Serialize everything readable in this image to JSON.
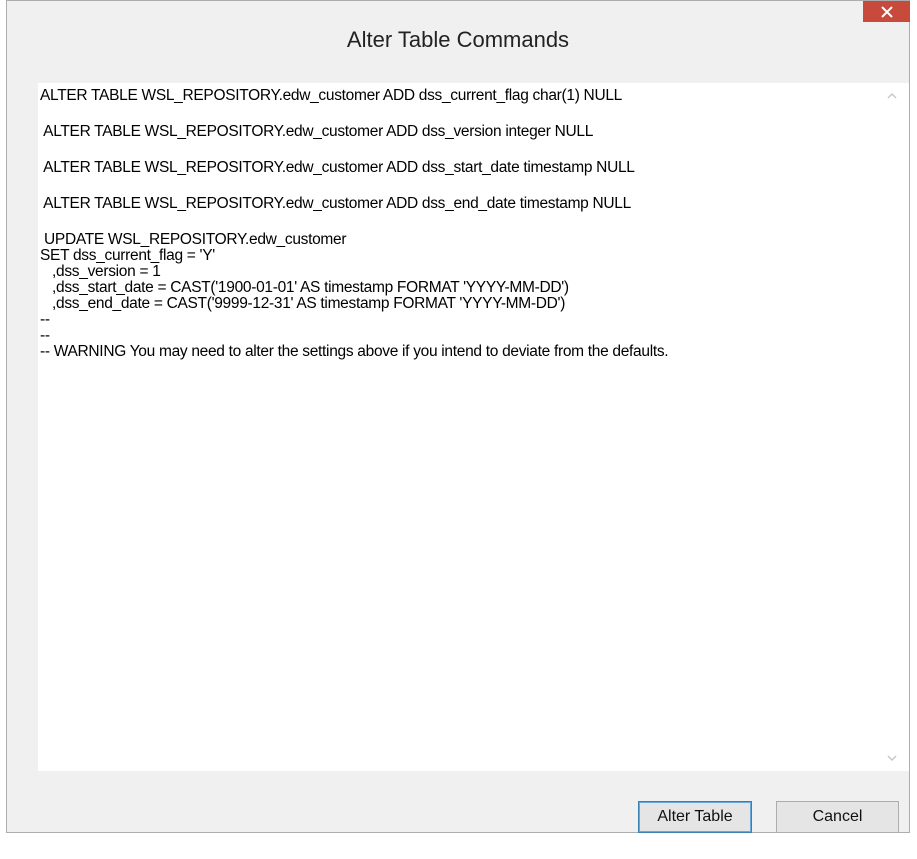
{
  "window": {
    "title": "Alter Table Commands"
  },
  "editor": {
    "lines": [
      "ALTER TABLE WSL_REPOSITORY.edw_customer ADD dss_current_flag char(1) NULL",
      "",
      " ALTER TABLE WSL_REPOSITORY.edw_customer ADD dss_version integer NULL",
      "",
      " ALTER TABLE WSL_REPOSITORY.edw_customer ADD dss_start_date timestamp NULL",
      "",
      " ALTER TABLE WSL_REPOSITORY.edw_customer ADD dss_end_date timestamp NULL",
      "",
      " UPDATE WSL_REPOSITORY.edw_customer",
      "SET dss_current_flag = 'Y'",
      "   ,dss_version = 1",
      "   ,dss_start_date = CAST('1900-01-01' AS timestamp FORMAT 'YYYY-MM-DD')",
      "   ,dss_end_date = CAST('9999-12-31' AS timestamp FORMAT 'YYYY-MM-DD')",
      "--",
      "--",
      "-- WARNING You may need to alter the settings above if you intend to deviate from the defaults."
    ]
  },
  "buttons": {
    "alter_table": "Alter Table",
    "cancel": "Cancel"
  },
  "icons": {
    "close": "close-icon",
    "scroll_up": "chevron-up-icon",
    "scroll_down": "chevron-down-icon"
  },
  "colors": {
    "close_button": "#c74a3c",
    "window_background": "#f0f0f0",
    "editor_background": "#ffffff"
  }
}
